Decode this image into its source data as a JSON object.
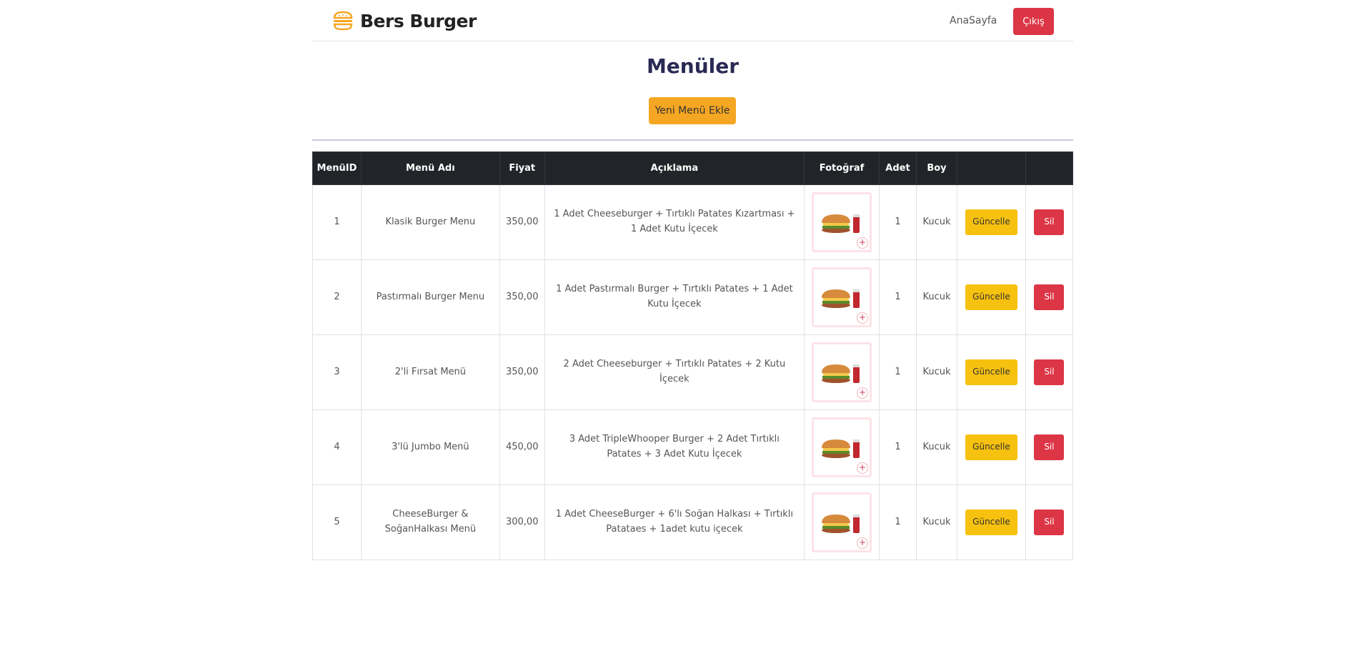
{
  "navbar": {
    "brand": "Bers Burger",
    "home_link": "AnaSayfa",
    "logout_label": "Çıkış"
  },
  "page": {
    "title": "Menüler",
    "add_button": "Yeni Menü Ekle"
  },
  "table": {
    "headers": [
      "MenüID",
      "Menü Adı",
      "Fiyat",
      "Açıklama",
      "Fotoğraf",
      "Adet",
      "Boy",
      "",
      ""
    ],
    "update_label": "Güncelle",
    "delete_label": "Sil",
    "rows": [
      {
        "id": "1",
        "name": "Klasik Burger Menu",
        "price": "350,00",
        "description": "1 Adet Cheeseburger + Tırtıklı Patates Kızartması + 1 Adet Kutu İçecek",
        "qty": "1",
        "size": "Kucuk"
      },
      {
        "id": "2",
        "name": "Pastırmalı Burger Menu",
        "price": "350,00",
        "description": "1 Adet Pastırmalı Burger + Tırtıklı Patates + 1 Adet Kutu İçecek",
        "qty": "1",
        "size": "Kucuk"
      },
      {
        "id": "3",
        "name": "2'li Fırsat Menü",
        "price": "350,00",
        "description": "2 Adet Cheeseburger + Tırtıklı Patates + 2 Kutu İçecek",
        "qty": "1",
        "size": "Kucuk"
      },
      {
        "id": "4",
        "name": "3'lü Jumbo Menü",
        "price": "450,00",
        "description": "3 Adet TripleWhooper Burger + 2 Adet Tırtıklı Patates + 3 Adet Kutu İçecek",
        "qty": "1",
        "size": "Kucuk"
      },
      {
        "id": "5",
        "name": "CheeseBurger & SoğanHalkası Menü",
        "price": "300,00",
        "description": "1 Adet CheeseBurger + 6'lı Soğan Halkası + Tırtıklı Patataes + 1adet kutu içecek",
        "qty": "1",
        "size": "Kucuk"
      }
    ]
  },
  "colors": {
    "danger": "#dc3545",
    "accent": "#f5a623",
    "warning": "#f7c10f",
    "header_bg": "#212529",
    "title": "#2a2a55"
  }
}
